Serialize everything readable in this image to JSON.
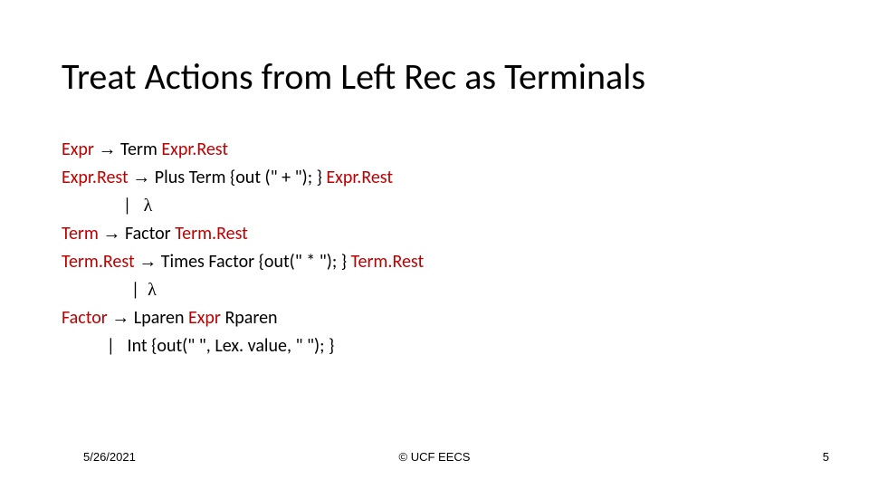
{
  "title": "Treat Actions from Left Rec as Terminals",
  "grammar": {
    "line1": {
      "lhs": "Expr",
      "arrow": "→",
      "rhs_a": "Term",
      "rhs_b": "Expr.Rest"
    },
    "line2": {
      "lhs": "Expr.Rest",
      "arrow": "→",
      "rhs_a": "Plus",
      "rhs_b": "Term",
      "action": "{out (\" + \"); }",
      "tail": "Expr.Rest"
    },
    "line3": {
      "indent": "               ",
      "bar": "|",
      "gap": "   ",
      "lambda": "λ"
    },
    "line4": {
      "lhs": "Term",
      "arrow": "→",
      "rhs_a": "Factor",
      "rhs_b": "Term.Rest"
    },
    "line5": {
      "lhs": "Term.Rest",
      "arrow": "→",
      "rhs_a": "Times",
      "rhs_b": "Factor",
      "action": "{out(\" * \"); }",
      "tail": "Term.Rest"
    },
    "line6": {
      "indent": "                 ",
      "bar": "|",
      "gap": "  ",
      "lambda": "λ"
    },
    "line7": {
      "lhs": "Factor",
      "arrow": "→",
      "rhs_a": "Lparen",
      "rhs_b": "Expr",
      "rhs_c": "Rparen"
    },
    "line8": {
      "indent": "           ",
      "bar": "|",
      "gap": "   ",
      "token": "Int",
      "action": "{out(\" \", Lex. value, \" \"); }"
    }
  },
  "footer": {
    "date": "5/26/2021",
    "center": "© UCF EECS",
    "page": "5"
  }
}
